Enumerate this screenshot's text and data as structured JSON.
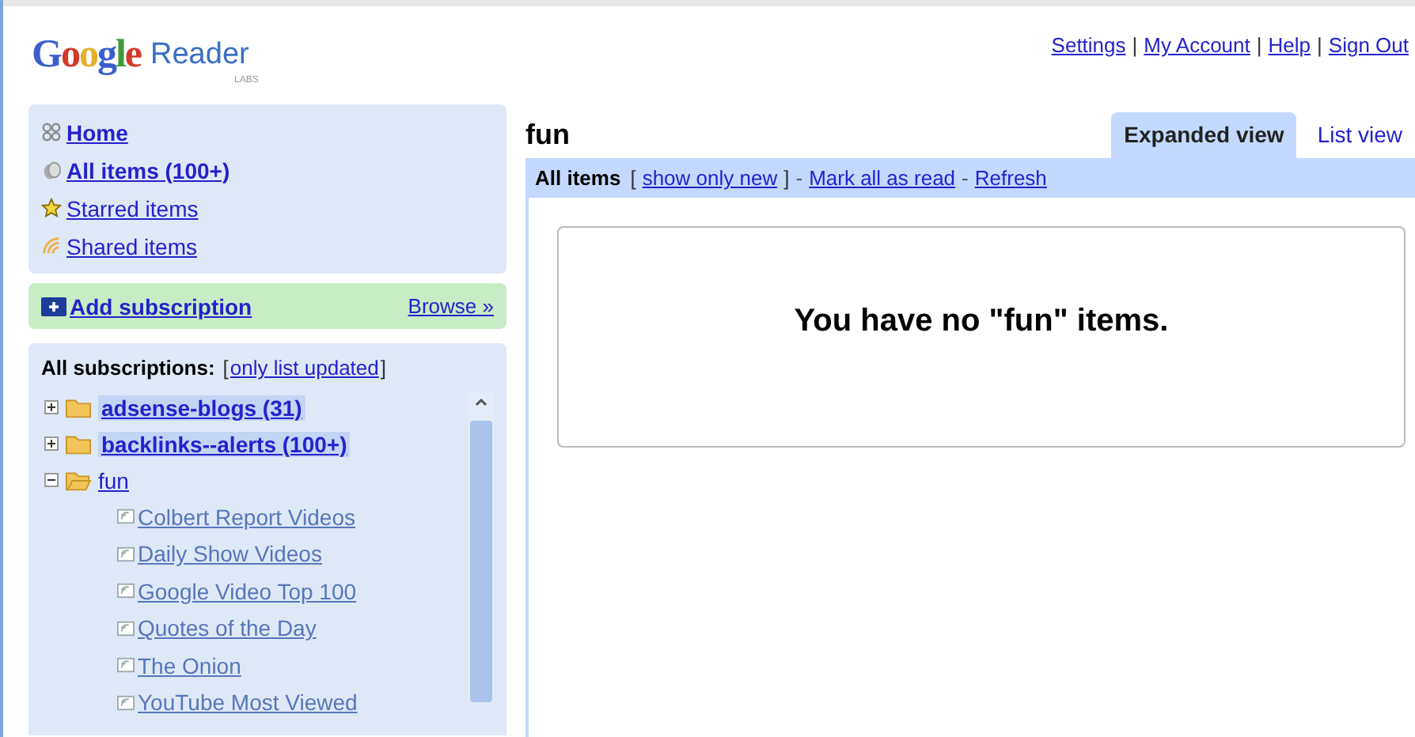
{
  "logo": {
    "brand": "Google",
    "product": "Reader",
    "tag": "LABS"
  },
  "top_links": {
    "separator": "|",
    "links": [
      "Settings",
      "My Account",
      "Help",
      "Sign Out"
    ]
  },
  "nav": [
    {
      "kind": "home",
      "label": "Home",
      "bold": true
    },
    {
      "kind": "all",
      "label": "All items (100+)",
      "bold": true
    },
    {
      "kind": "star",
      "label": "Starred items",
      "bold": false
    },
    {
      "kind": "shared",
      "label": "Shared items",
      "bold": false
    }
  ],
  "add_subscription": {
    "label": "Add subscription",
    "browse": "Browse »"
  },
  "subscriptions": {
    "title": "All subscriptions:",
    "filter": {
      "open": "[",
      "label": "only list updated",
      "close": "]"
    },
    "tree": [
      {
        "label": "adsense-blogs (31)",
        "unread": true,
        "expanded": false
      },
      {
        "label": "backlinks--alerts (100+)",
        "unread": true,
        "expanded": false
      },
      {
        "label": "fun",
        "unread": false,
        "expanded": true,
        "children": [
          {
            "label": "Colbert Report Videos"
          },
          {
            "label": "Daily Show Videos"
          },
          {
            "label": "Google Video Top 100"
          },
          {
            "label": "Quotes of the Day"
          },
          {
            "label": "The Onion"
          },
          {
            "label": "YouTube Most Viewed"
          }
        ]
      }
    ]
  },
  "main": {
    "title": "fun",
    "tabs": [
      {
        "label": "Expanded view",
        "selected": true
      },
      {
        "label": "List view",
        "selected": false
      }
    ],
    "toolbar": {
      "filter_label": "All items",
      "open": "[",
      "filter_link": "show only new",
      "close": "]",
      "separator": "-",
      "actions": [
        "Mark all as read",
        "Refresh"
      ]
    },
    "message": "You have no \"fun\" items."
  }
}
